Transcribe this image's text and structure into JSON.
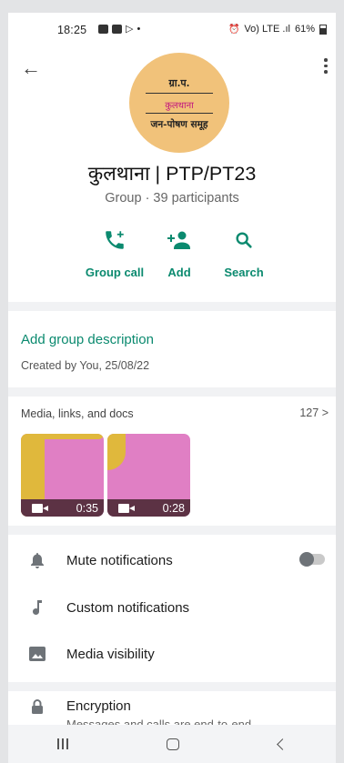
{
  "status_bar": {
    "time": "18:25",
    "right_text": "Vo) LTE .ıl",
    "battery": "61%"
  },
  "group": {
    "avatar_line1": "ग्रा.प.",
    "avatar_line2": "कुलथाना",
    "avatar_line3": "जन-पोषण समूह",
    "name": "कुलथाना | PTP/PT23",
    "subtitle": "Group · 39 participants"
  },
  "actions": [
    {
      "label": "Group call",
      "icon": "add-call-icon"
    },
    {
      "label": "Add",
      "icon": "add-person-icon"
    },
    {
      "label": "Search",
      "icon": "search-icon"
    }
  ],
  "description": {
    "add_label": "Add group description",
    "created": "Created by You, 25/08/22"
  },
  "media": {
    "header": "Media, links, and docs",
    "count": "127 >",
    "videos": [
      {
        "duration": "0:35"
      },
      {
        "duration": "0:28"
      }
    ]
  },
  "settings": [
    {
      "label": "Mute notifications",
      "icon": "bell-icon",
      "toggle": false
    },
    {
      "label": "Custom notifications",
      "icon": "music-note-icon"
    },
    {
      "label": "Media visibility",
      "icon": "image-icon"
    }
  ],
  "encryption": {
    "title": "Encryption",
    "subtitle": "Messages and calls are end-to-end"
  },
  "colors": {
    "accent": "#0b8a6f",
    "background": "#e3e4e6"
  }
}
